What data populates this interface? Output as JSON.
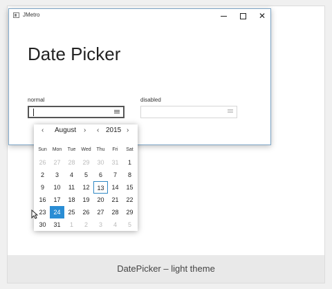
{
  "window": {
    "title": "JMetro",
    "minimize_icon": "minimize-icon",
    "maximize_icon": "maximize-icon",
    "close_icon": "close-icon",
    "close_glyph": "✕"
  },
  "page": {
    "title": "Date Picker"
  },
  "normal_field": {
    "label": "normal",
    "value": ""
  },
  "disabled_field": {
    "label": "disabled",
    "value": ""
  },
  "calendar": {
    "prev_arrow": "‹",
    "next_arrow": "›",
    "month": "August",
    "year": "2015",
    "weekdays": [
      "Sun",
      "Mon",
      "Tue",
      "Wed",
      "Thu",
      "Fri",
      "Sat"
    ],
    "weeks": [
      [
        {
          "d": "26",
          "o": true
        },
        {
          "d": "27",
          "o": true
        },
        {
          "d": "28",
          "o": true
        },
        {
          "d": "29",
          "o": true
        },
        {
          "d": "30",
          "o": true
        },
        {
          "d": "31",
          "o": true
        },
        {
          "d": "1"
        }
      ],
      [
        {
          "d": "2"
        },
        {
          "d": "3"
        },
        {
          "d": "4"
        },
        {
          "d": "5"
        },
        {
          "d": "6"
        },
        {
          "d": "7"
        },
        {
          "d": "8"
        }
      ],
      [
        {
          "d": "9"
        },
        {
          "d": "10"
        },
        {
          "d": "11"
        },
        {
          "d": "12"
        },
        {
          "d": "13",
          "today": true
        },
        {
          "d": "14"
        },
        {
          "d": "15"
        }
      ],
      [
        {
          "d": "16"
        },
        {
          "d": "17"
        },
        {
          "d": "18"
        },
        {
          "d": "19"
        },
        {
          "d": "20"
        },
        {
          "d": "21"
        },
        {
          "d": "22"
        }
      ],
      [
        {
          "d": "23"
        },
        {
          "d": "24",
          "sel": true
        },
        {
          "d": "25"
        },
        {
          "d": "26"
        },
        {
          "d": "27"
        },
        {
          "d": "28"
        },
        {
          "d": "29"
        }
      ],
      [
        {
          "d": "30"
        },
        {
          "d": "31"
        },
        {
          "d": "1",
          "o": true
        },
        {
          "d": "2",
          "o": true
        },
        {
          "d": "3",
          "o": true
        },
        {
          "d": "4",
          "o": true
        },
        {
          "d": "5",
          "o": true
        }
      ]
    ]
  },
  "caption": "DatePicker – light theme",
  "colors": {
    "accent": "#2a8dd4",
    "window_border": "#7ba3c4"
  }
}
